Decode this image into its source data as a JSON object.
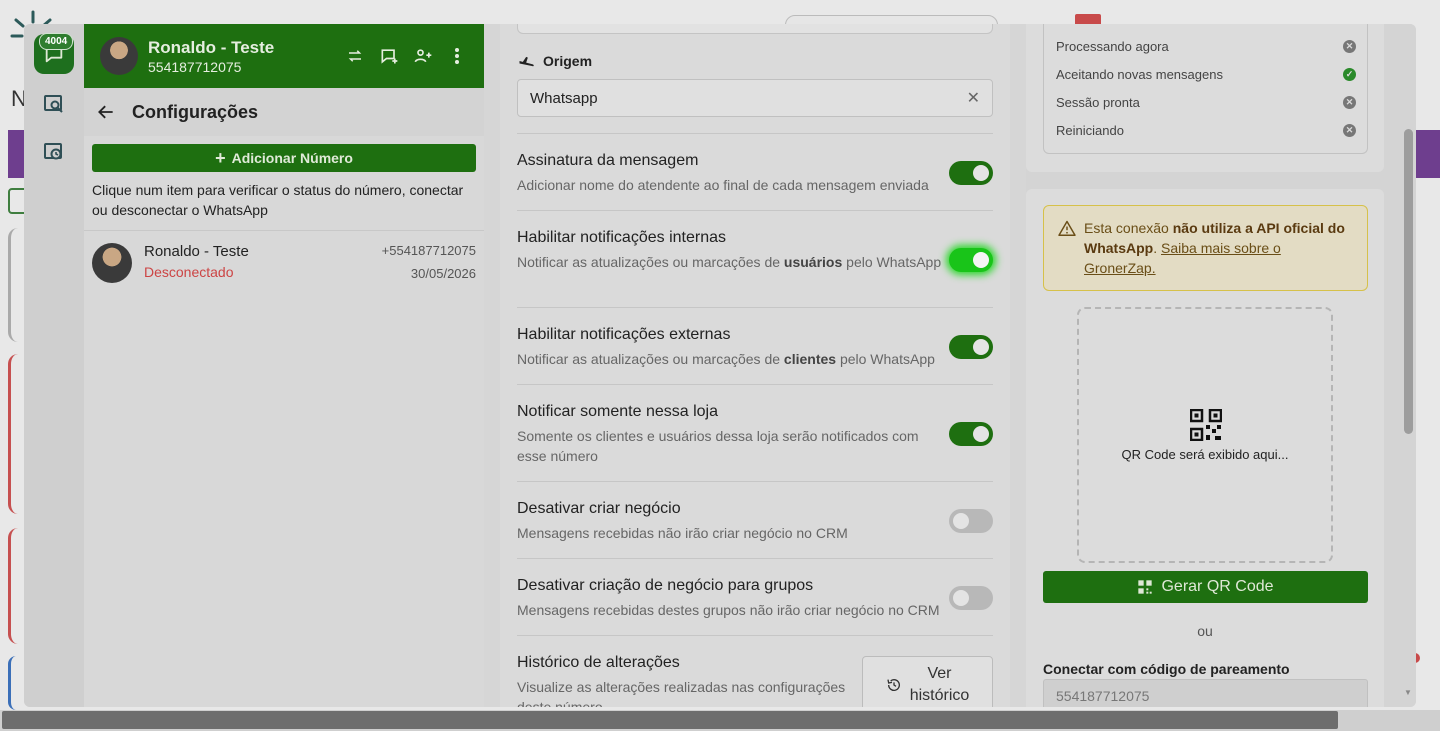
{
  "rail": {
    "badge": "4004"
  },
  "contact": {
    "name": "Ronaldo - Teste",
    "number": "554187712075"
  },
  "config": {
    "title": "Configurações",
    "add_button": "Adicionar Número",
    "hint": "Clique num item para verificar o status do número, conectar ou desconectar o WhatsApp",
    "items": [
      {
        "name": "Ronaldo - Teste",
        "status": "Desconectado",
        "phone": "+554187712075",
        "date": "30/05/2026"
      }
    ]
  },
  "origin": {
    "label": "Origem",
    "value": "Whatsapp"
  },
  "settings": [
    {
      "title": "Assinatura da mensagem",
      "desc": "Adicionar nome do atendente ao final de cada mensagem enviada",
      "on": true
    },
    {
      "title": "Habilitar notificações internas",
      "desc_pre": "Notificar as atualizações ou marcações de ",
      "desc_bold": "usuários",
      "desc_post": " pelo WhatsApp",
      "on": true
    },
    {
      "title": "Habilitar notificações externas",
      "desc_pre": "Notificar as atualizações ou marcações de ",
      "desc_bold": "clientes",
      "desc_post": " pelo WhatsApp",
      "on": true
    },
    {
      "title": "Notificar somente nessa loja",
      "desc": "Somente os clientes e usuários dessa loja serão notificados com esse número",
      "on": true
    },
    {
      "title": "Desativar criar negócio",
      "desc": "Mensagens recebidas não irão criar negócio no CRM",
      "on": false
    },
    {
      "title": "Desativar criação de negócio para grupos",
      "desc": "Mensagens recebidas destes grupos não irão criar negócio no CRM",
      "on": false
    },
    {
      "title": "Histórico de alterações",
      "desc": "Visualize as alterações realizadas nas configurações deste número"
    }
  ],
  "history_button": {
    "line1": "Ver",
    "line2": "histórico"
  },
  "status": [
    {
      "label": "Processando agora",
      "ok": false
    },
    {
      "label": "Aceitando novas mensagens",
      "ok": true
    },
    {
      "label": "Sessão pronta",
      "ok": false
    },
    {
      "label": "Reiniciando",
      "ok": false
    }
  ],
  "warning": {
    "pre": "Esta conexão ",
    "bold": "não utiliza a API oficial do WhatsApp",
    "dot": ". ",
    "link": "Saiba mais sobre o GronerZap."
  },
  "qr": {
    "placeholder": "QR Code será exibido aqui...",
    "button": "Gerar QR Code",
    "or": "ou"
  },
  "pairing": {
    "label": "Conectar com código de pareamento",
    "value": "554187712075"
  },
  "colors": {
    "brand_green": "#1e6f10",
    "toggle_on": "#1e6f10",
    "toggle_highlight": "#19c419",
    "disconnected": "#cc4444",
    "warning_border": "#d6c14a"
  }
}
